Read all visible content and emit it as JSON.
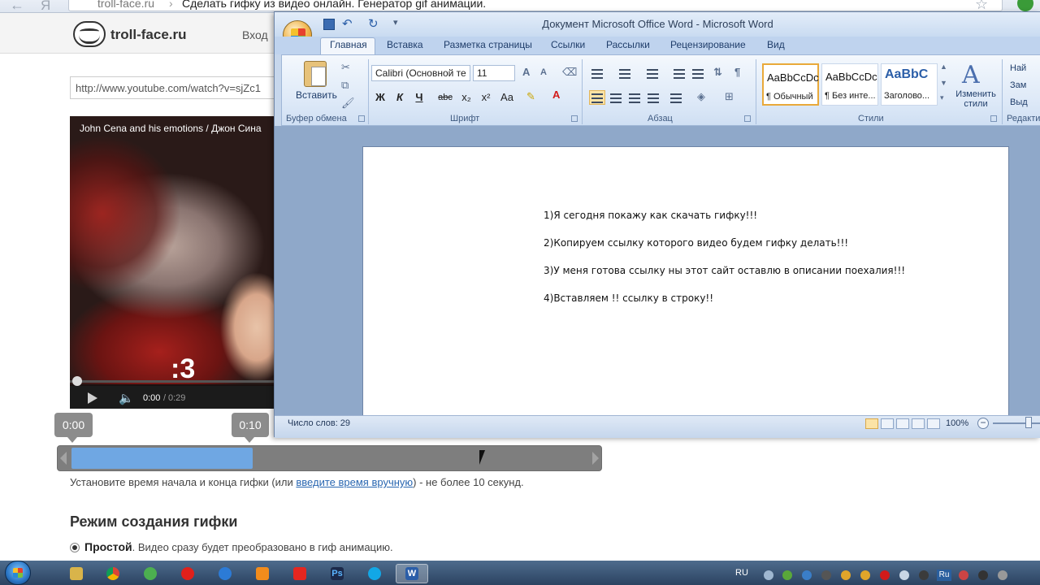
{
  "browser": {
    "url_domain": "troll-face.ru",
    "url_separator": "›",
    "tab_title": "Сделать гифку из видео онлайн. Генератор gif анимации.",
    "back_glyph": "←",
    "yandex_glyph": "Я",
    "star_glyph": "☆"
  },
  "site": {
    "logo_text": "troll-face.ru",
    "login_label": "Вход",
    "url_input_value": "http://www.youtube.com/watch?v=sjZc1",
    "video": {
      "title": "John Cena and his emotions / Джон Сина",
      "channel_logo": ":3",
      "current_time": "0:00",
      "separator": "/",
      "total_time": "0:29"
    },
    "range": {
      "start_label": "0:00",
      "end_label": "0:10",
      "start_fraction": 0.0,
      "end_fraction": 0.34
    },
    "hint_before": "Установите время начала и конца гифки (или ",
    "hint_link": "введите время вручную",
    "hint_after": ") - не более 10 секунд.",
    "mode_title": "Режим создания гифки",
    "mode_simple_label": "Простой",
    "mode_simple_desc": ". Видео сразу будет преобразовано в гиф анимацию."
  },
  "word": {
    "title": "Документ Microsoft Office Word - Microsoft Word",
    "tabs": [
      "Главная",
      "Вставка",
      "Разметка страницы",
      "Ссылки",
      "Рассылки",
      "Рецензирование",
      "Вид"
    ],
    "groups": {
      "clipboard": "Буфер обмена",
      "font": "Шрифт",
      "paragraph": "Абзац",
      "styles": "Стили",
      "editing": "Редакти"
    },
    "paste_label": "Вставить",
    "font_name": "Calibri (Основной те",
    "font_size": "11",
    "format_buttons": [
      "Ж",
      "К",
      "Ч",
      "abc",
      "x₂",
      "x²",
      "Aa"
    ],
    "styles": [
      {
        "sample": "AaBbCcDc",
        "name": "¶ Обычный"
      },
      {
        "sample": "AaBbCcDc",
        "name": "¶ Без инте..."
      },
      {
        "sample": "AaBbC",
        "name": "Заголово..."
      }
    ],
    "change_styles_label": "Изменить стили",
    "edit_items": [
      "Най",
      "Зам",
      "Выд"
    ],
    "document_lines": [
      "1)Я сегодня покажу как скачать гифку!!!",
      "2)Копируем ссылку которого видео будем гифку делать!!!",
      "3)У меня готова ссылку ны этот сайт оставлю в описании поехалия!!!",
      "4)Вставляем !! ссылку в строку!!"
    ],
    "word_count": "Число слов: 29",
    "zoom": "100%"
  },
  "taskbar": {
    "language": "RU",
    "tray_lang": "Ru",
    "photoshop_label": "Ps",
    "word_label": "W"
  }
}
